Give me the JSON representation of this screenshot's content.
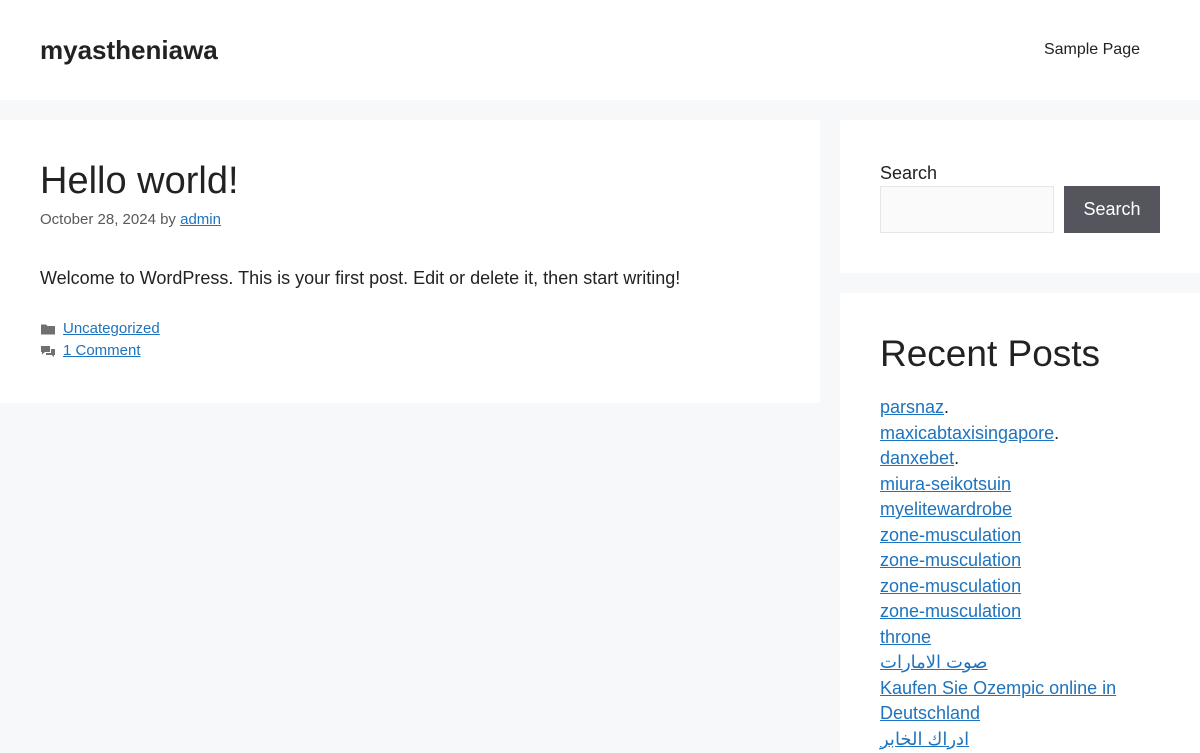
{
  "header": {
    "site_title": "myastheniawa",
    "nav": {
      "sample_page": "Sample Page"
    }
  },
  "post": {
    "title": "Hello world!",
    "date": "October 28, 2024",
    "by": "by",
    "author": "admin",
    "content": "Welcome to WordPress. This is your first post. Edit or delete it, then start writing!",
    "category": "Uncategorized",
    "comments": "1 Comment",
    "category_icon": "folder-icon",
    "comment_icon": "comments-icon"
  },
  "sidebar": {
    "search": {
      "label": "Search",
      "input_value": "",
      "button_label": "Search"
    },
    "recent_posts": {
      "title": "Recent Posts",
      "items": [
        {
          "label": "parsnaz",
          "suffix": "."
        },
        {
          "label": "maxicabtaxisingapore",
          "suffix": "."
        },
        {
          "label": "danxebet",
          "suffix": "."
        },
        {
          "label": "miura-seikotsuin",
          "suffix": ""
        },
        {
          "label": "myelitewardrobe",
          "suffix": ""
        },
        {
          "label": "zone-musculation",
          "suffix": ""
        },
        {
          "label": "zone-musculation",
          "suffix": ""
        },
        {
          "label": "zone-musculation",
          "suffix": ""
        },
        {
          "label": "zone-musculation",
          "suffix": ""
        },
        {
          "label": "throne",
          "suffix": ""
        },
        {
          "label": "صوت الامارات",
          "suffix": ""
        },
        {
          "label": "Kaufen Sie Ozempic online in Deutschland",
          "suffix": ""
        },
        {
          "label": "ادراك الخابر",
          "suffix": ""
        }
      ]
    }
  },
  "colors": {
    "link": "#1e73be",
    "button_bg": "#55555e",
    "page_bg": "#f7f8f9"
  }
}
